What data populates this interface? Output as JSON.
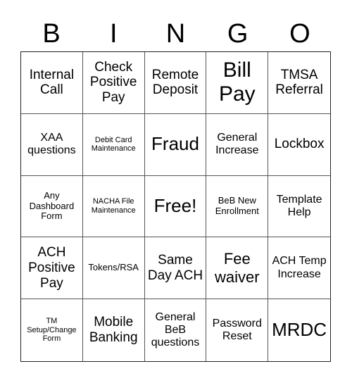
{
  "header": {
    "letters": [
      "B",
      "I",
      "N",
      "G",
      "O"
    ]
  },
  "cells": [
    "Internal Call",
    "Check Positive Pay",
    "Remote Deposit",
    "Bill Pay",
    "TMSA Referral",
    "XAA questions",
    "Debit Card Maintenance",
    "Fraud",
    "General Increase",
    "Lockbox",
    "Any Dashboard Form",
    "NACHA File Maintenance",
    "Free!",
    "BeB New Enrollment",
    "Template Help",
    "ACH Positive Pay",
    "Tokens/RSA",
    "Same Day ACH",
    "Fee waiver",
    "ACH Temp Increase",
    "TM Setup/Change Form",
    "Mobile Banking",
    "General BeB questions",
    "Password Reset",
    "MRDC"
  ]
}
